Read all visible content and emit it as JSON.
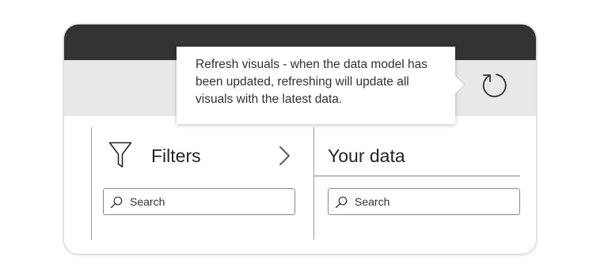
{
  "tooltip": {
    "text": "Refresh visuals - when the data model has been updated, refreshing will update all visuals with the latest data."
  },
  "filters_pane": {
    "title": "Filters",
    "search": {
      "placeholder": "Search",
      "value": ""
    }
  },
  "data_pane": {
    "title": "Your data",
    "search": {
      "placeholder": "Search",
      "value": ""
    }
  },
  "icons": {
    "refresh": "refresh-icon",
    "filter": "filter-funnel-icon",
    "expand": "chevron-right-icon",
    "search": "search-icon"
  },
  "colors": {
    "title_bar": "#333333",
    "toolbar": "#e8e8e8",
    "text": "#252423",
    "border": "#8a8886"
  }
}
